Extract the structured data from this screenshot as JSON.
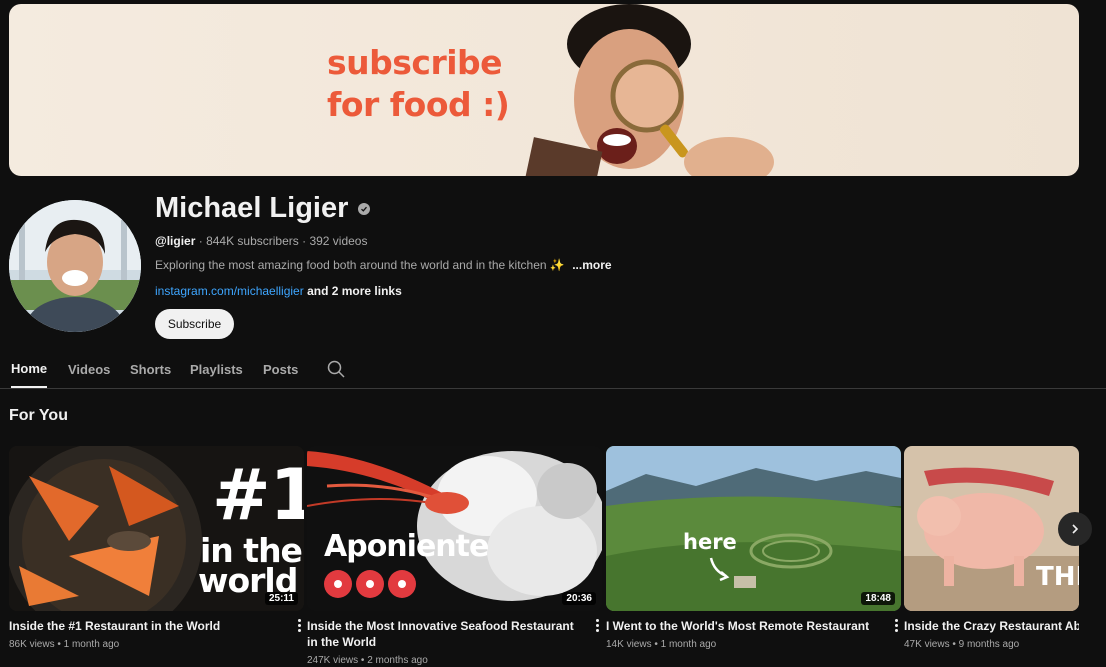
{
  "banner": {
    "line1": "subscribe",
    "line2": "for food :)"
  },
  "channel": {
    "name": "Michael Ligier",
    "handle": "@ligier",
    "stats": "· 844K subscribers · 392 videos",
    "description": "Exploring the most amazing food both around the world and in the kitchen ✨",
    "more": "...more",
    "link": "instagram.com/michaelligier",
    "more_links": "and 2 more links",
    "subscribe_label": "Subscribe"
  },
  "tabs": [
    {
      "label": "Home"
    },
    {
      "label": "Videos"
    },
    {
      "label": "Shorts"
    },
    {
      "label": "Playlists"
    },
    {
      "label": "Posts"
    }
  ],
  "section_title": "For You",
  "videos": [
    {
      "title": "Inside the #1 Restaurant in the World",
      "meta": "86K views • 1 month ago",
      "duration": "25:11",
      "thumb_text": [
        "#1",
        "in the",
        "world"
      ]
    },
    {
      "title": "Inside the Most Innovative Seafood Restaurant in the World",
      "meta": "247K views • 2 months ago",
      "duration": "20:36",
      "thumb_text": [
        "Aponiente"
      ]
    },
    {
      "title": "I Went to the World's Most Remote Restaurant",
      "meta": "14K views • 1 month ago",
      "duration": "18:48",
      "thumb_text": [
        "here"
      ]
    },
    {
      "title": "Inside the Crazy Restaurant Above",
      "meta": "47K views • 9 months ago",
      "duration": "",
      "thumb_text": [
        "THI"
      ]
    }
  ],
  "colors": {
    "background": "#0f0f0f",
    "banner_text": "#ec5a3a",
    "link": "#3ea6ff"
  }
}
